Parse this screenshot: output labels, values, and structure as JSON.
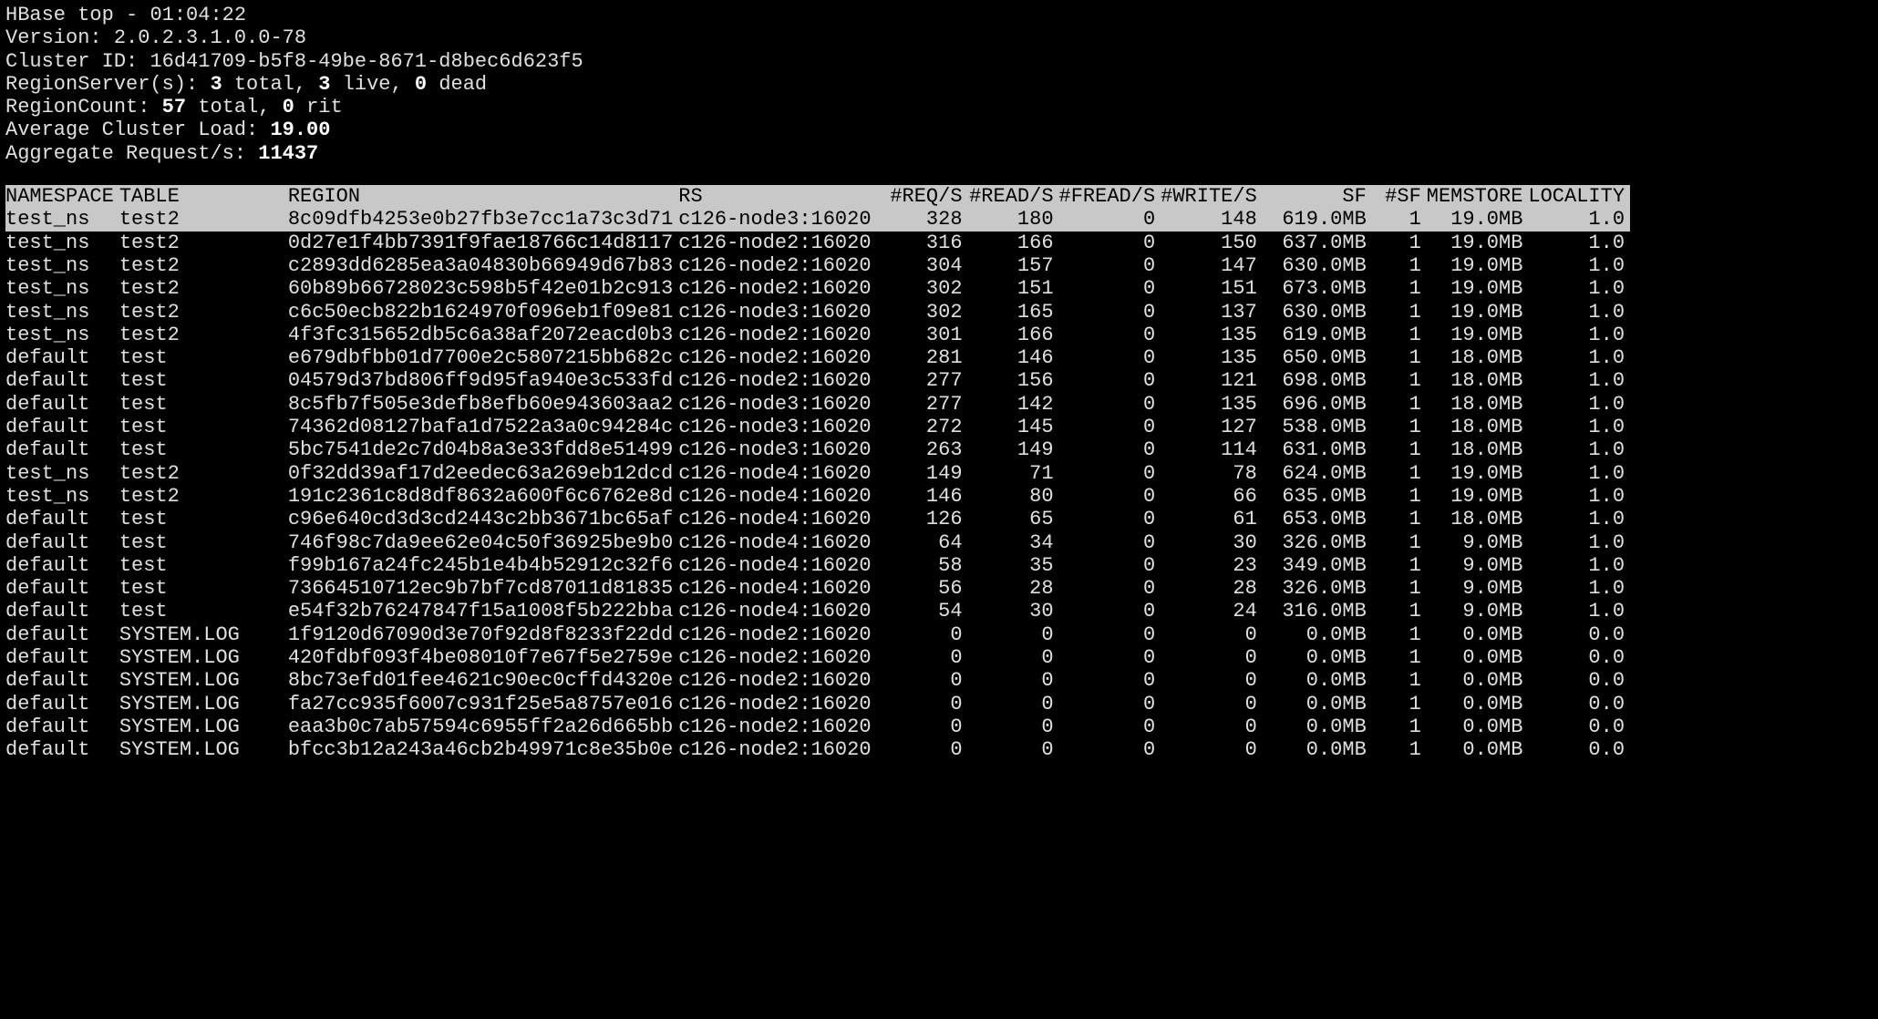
{
  "header": {
    "title_label": "HBase top",
    "time": "01:04:22",
    "version_label": "Version",
    "version_value": "2.0.2.3.1.0.0-78",
    "cluster_id_label": "Cluster ID",
    "cluster_id_value": "16d41709-b5f8-49be-8671-d8bec6d623f5",
    "regionserver_label": "RegionServer(s)",
    "rs_total": "3",
    "rs_total_word": "total",
    "rs_live": "3",
    "rs_live_word": "live",
    "rs_dead": "0",
    "rs_dead_word": "dead",
    "regioncount_label": "RegionCount",
    "rc_total": "57",
    "rc_total_word": "total",
    "rc_rit": "0",
    "rc_rit_word": "rit",
    "avgload_label": "Average Cluster Load",
    "avgload_value": "19.00",
    "aggreq_label": "Aggregate Request/s",
    "aggreq_value": "11437"
  },
  "columns": [
    "NAMESPACE",
    "TABLE",
    "REGION",
    "RS",
    "#REQ/S",
    "#READ/S",
    "#FREAD/S",
    "#WRITE/S",
    "SF",
    "#SF",
    "MEMSTORE",
    "LOCALITY"
  ],
  "selected_row_index": 0,
  "rows": [
    {
      "ns": "test_ns",
      "table": "test2",
      "region": "8c09dfb4253e0b27fb3e7cc1a73c3d71",
      "rs": "c126-node3:16020",
      "req": "328",
      "read": "180",
      "fread": "0",
      "write": "148",
      "sf": "619.0MB",
      "nsf": "1",
      "mem": "19.0MB",
      "loc": "1.0"
    },
    {
      "ns": "test_ns",
      "table": "test2",
      "region": "0d27e1f4bb7391f9fae18766c14d8117",
      "rs": "c126-node2:16020",
      "req": "316",
      "read": "166",
      "fread": "0",
      "write": "150",
      "sf": "637.0MB",
      "nsf": "1",
      "mem": "19.0MB",
      "loc": "1.0"
    },
    {
      "ns": "test_ns",
      "table": "test2",
      "region": "c2893dd6285ea3a04830b66949d67b83",
      "rs": "c126-node2:16020",
      "req": "304",
      "read": "157",
      "fread": "0",
      "write": "147",
      "sf": "630.0MB",
      "nsf": "1",
      "mem": "19.0MB",
      "loc": "1.0"
    },
    {
      "ns": "test_ns",
      "table": "test2",
      "region": "60b89b66728023c598b5f42e01b2c913",
      "rs": "c126-node2:16020",
      "req": "302",
      "read": "151",
      "fread": "0",
      "write": "151",
      "sf": "673.0MB",
      "nsf": "1",
      "mem": "19.0MB",
      "loc": "1.0"
    },
    {
      "ns": "test_ns",
      "table": "test2",
      "region": "c6c50ecb822b1624970f096eb1f09e81",
      "rs": "c126-node3:16020",
      "req": "302",
      "read": "165",
      "fread": "0",
      "write": "137",
      "sf": "630.0MB",
      "nsf": "1",
      "mem": "19.0MB",
      "loc": "1.0"
    },
    {
      "ns": "test_ns",
      "table": "test2",
      "region": "4f3fc315652db5c6a38af2072eacd0b3",
      "rs": "c126-node2:16020",
      "req": "301",
      "read": "166",
      "fread": "0",
      "write": "135",
      "sf": "619.0MB",
      "nsf": "1",
      "mem": "19.0MB",
      "loc": "1.0"
    },
    {
      "ns": "default",
      "table": "test",
      "region": "e679dbfbb01d7700e2c5807215bb682c",
      "rs": "c126-node2:16020",
      "req": "281",
      "read": "146",
      "fread": "0",
      "write": "135",
      "sf": "650.0MB",
      "nsf": "1",
      "mem": "18.0MB",
      "loc": "1.0"
    },
    {
      "ns": "default",
      "table": "test",
      "region": "04579d37bd806ff9d95fa940e3c533fd",
      "rs": "c126-node2:16020",
      "req": "277",
      "read": "156",
      "fread": "0",
      "write": "121",
      "sf": "698.0MB",
      "nsf": "1",
      "mem": "18.0MB",
      "loc": "1.0"
    },
    {
      "ns": "default",
      "table": "test",
      "region": "8c5fb7f505e3defb8efb60e943603aa2",
      "rs": "c126-node3:16020",
      "req": "277",
      "read": "142",
      "fread": "0",
      "write": "135",
      "sf": "696.0MB",
      "nsf": "1",
      "mem": "18.0MB",
      "loc": "1.0"
    },
    {
      "ns": "default",
      "table": "test",
      "region": "74362d08127bafa1d7522a3a0c94284c",
      "rs": "c126-node3:16020",
      "req": "272",
      "read": "145",
      "fread": "0",
      "write": "127",
      "sf": "538.0MB",
      "nsf": "1",
      "mem": "18.0MB",
      "loc": "1.0"
    },
    {
      "ns": "default",
      "table": "test",
      "region": "5bc7541de2c7d04b8a3e33fdd8e51499",
      "rs": "c126-node3:16020",
      "req": "263",
      "read": "149",
      "fread": "0",
      "write": "114",
      "sf": "631.0MB",
      "nsf": "1",
      "mem": "18.0MB",
      "loc": "1.0"
    },
    {
      "ns": "test_ns",
      "table": "test2",
      "region": "0f32dd39af17d2eedec63a269eb12dcd",
      "rs": "c126-node4:16020",
      "req": "149",
      "read": "71",
      "fread": "0",
      "write": "78",
      "sf": "624.0MB",
      "nsf": "1",
      "mem": "19.0MB",
      "loc": "1.0"
    },
    {
      "ns": "test_ns",
      "table": "test2",
      "region": "191c2361c8d8df8632a600f6c6762e8d",
      "rs": "c126-node4:16020",
      "req": "146",
      "read": "80",
      "fread": "0",
      "write": "66",
      "sf": "635.0MB",
      "nsf": "1",
      "mem": "19.0MB",
      "loc": "1.0"
    },
    {
      "ns": "default",
      "table": "test",
      "region": "c96e640cd3d3cd2443c2bb3671bc65af",
      "rs": "c126-node4:16020",
      "req": "126",
      "read": "65",
      "fread": "0",
      "write": "61",
      "sf": "653.0MB",
      "nsf": "1",
      "mem": "18.0MB",
      "loc": "1.0"
    },
    {
      "ns": "default",
      "table": "test",
      "region": "746f98c7da9ee62e04c50f36925be9b0",
      "rs": "c126-node4:16020",
      "req": "64",
      "read": "34",
      "fread": "0",
      "write": "30",
      "sf": "326.0MB",
      "nsf": "1",
      "mem": "9.0MB",
      "loc": "1.0"
    },
    {
      "ns": "default",
      "table": "test",
      "region": "f99b167a24fc245b1e4b4b52912c32f6",
      "rs": "c126-node4:16020",
      "req": "58",
      "read": "35",
      "fread": "0",
      "write": "23",
      "sf": "349.0MB",
      "nsf": "1",
      "mem": "9.0MB",
      "loc": "1.0"
    },
    {
      "ns": "default",
      "table": "test",
      "region": "73664510712ec9b7bf7cd87011d81835",
      "rs": "c126-node4:16020",
      "req": "56",
      "read": "28",
      "fread": "0",
      "write": "28",
      "sf": "326.0MB",
      "nsf": "1",
      "mem": "9.0MB",
      "loc": "1.0"
    },
    {
      "ns": "default",
      "table": "test",
      "region": "e54f32b76247847f15a1008f5b222bba",
      "rs": "c126-node4:16020",
      "req": "54",
      "read": "30",
      "fread": "0",
      "write": "24",
      "sf": "316.0MB",
      "nsf": "1",
      "mem": "9.0MB",
      "loc": "1.0"
    },
    {
      "ns": "default",
      "table": "SYSTEM.LOG",
      "region": "1f9120d67090d3e70f92d8f8233f22dd",
      "rs": "c126-node2:16020",
      "req": "0",
      "read": "0",
      "fread": "0",
      "write": "0",
      "sf": "0.0MB",
      "nsf": "1",
      "mem": "0.0MB",
      "loc": "0.0"
    },
    {
      "ns": "default",
      "table": "SYSTEM.LOG",
      "region": "420fdbf093f4be08010f7e67f5e2759e",
      "rs": "c126-node2:16020",
      "req": "0",
      "read": "0",
      "fread": "0",
      "write": "0",
      "sf": "0.0MB",
      "nsf": "1",
      "mem": "0.0MB",
      "loc": "0.0"
    },
    {
      "ns": "default",
      "table": "SYSTEM.LOG",
      "region": "8bc73efd01fee4621c90ec0cffd4320e",
      "rs": "c126-node2:16020",
      "req": "0",
      "read": "0",
      "fread": "0",
      "write": "0",
      "sf": "0.0MB",
      "nsf": "1",
      "mem": "0.0MB",
      "loc": "0.0"
    },
    {
      "ns": "default",
      "table": "SYSTEM.LOG",
      "region": "fa27cc935f6007c931f25e5a8757e016",
      "rs": "c126-node2:16020",
      "req": "0",
      "read": "0",
      "fread": "0",
      "write": "0",
      "sf": "0.0MB",
      "nsf": "1",
      "mem": "0.0MB",
      "loc": "0.0"
    },
    {
      "ns": "default",
      "table": "SYSTEM.LOG",
      "region": "eaa3b0c7ab57594c6955ff2a26d665bb",
      "rs": "c126-node2:16020",
      "req": "0",
      "read": "0",
      "fread": "0",
      "write": "0",
      "sf": "0.0MB",
      "nsf": "1",
      "mem": "0.0MB",
      "loc": "0.0"
    },
    {
      "ns": "default",
      "table": "SYSTEM.LOG",
      "region": "bfcc3b12a243a46cb2b49971c8e35b0e",
      "rs": "c126-node2:16020",
      "req": "0",
      "read": "0",
      "fread": "0",
      "write": "0",
      "sf": "0.0MB",
      "nsf": "1",
      "mem": "0.0MB",
      "loc": "0.0"
    }
  ]
}
